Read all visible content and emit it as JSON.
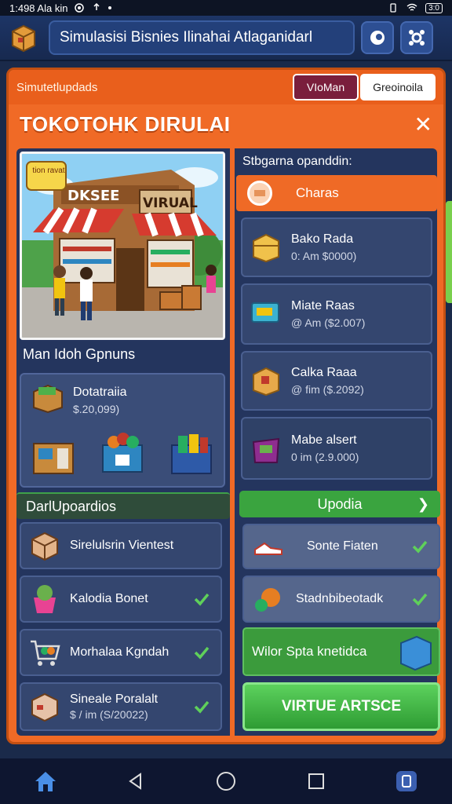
{
  "status": {
    "time": "1:498 Ala kin",
    "battery": "3:0"
  },
  "header": {
    "title": "Simulasisi Bisnies Ilinahai Atlaganidarl"
  },
  "panel": {
    "subtitle": "Simutetlupdads",
    "tab_active": "VIoMan",
    "tab_inactive": "Greoinoila",
    "title": "TOKOTOHK DIRULAI",
    "close": "✕"
  },
  "hero": {
    "badge": "tion ravat",
    "sign_left": "DKSEE",
    "sign_right": "VIRUAL"
  },
  "left": {
    "heading": "Man Idoh Gpnuns",
    "goods": {
      "title": "Dotatraiia",
      "price": "$.20,099)"
    },
    "section": "DarlUpoardios",
    "items": [
      {
        "label": "Sirelulsrin Vientest"
      },
      {
        "label": "Kalodia Bonet"
      },
      {
        "label": "Morhalaa Kgndah"
      },
      {
        "label": "Sineale Poralalt",
        "sub": "$ / im (S/20022)"
      }
    ]
  },
  "right": {
    "heading": "Stbgarna opanddin:",
    "active_option": "Charas",
    "options": [
      {
        "label": "Bako Rada",
        "sub": "0: Am $0000)"
      },
      {
        "label": "Miate Raas",
        "sub": "@ Am ($2.007)"
      },
      {
        "label": "Calka Raaa",
        "sub": "@ fim ($.2092)"
      },
      {
        "label": "Mabe alsert",
        "sub": "0 im (2.9.000)"
      }
    ],
    "section": "Upodia",
    "items": [
      {
        "label": "Sonte Fiaten"
      },
      {
        "label": "Stadnbibeotadk"
      }
    ],
    "promo": "Wilor Spta knetidca",
    "cta": "VIRTUE ARTSCE"
  },
  "colors": {
    "accent": "#f06a26",
    "panel": "#24355e",
    "green": "#3aa43f"
  }
}
